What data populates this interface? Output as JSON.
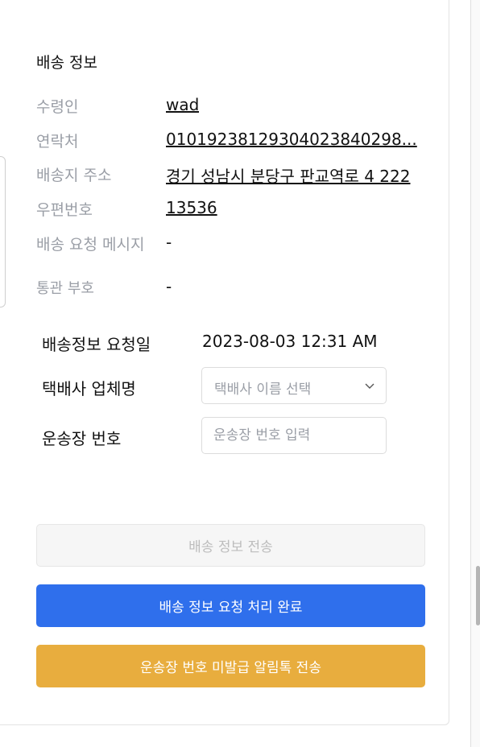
{
  "shipping_info": {
    "title": "배송 정보",
    "rows": [
      {
        "label": "수령인",
        "value": "wad"
      },
      {
        "label": "연락처",
        "value": "01019238129304023840298..."
      },
      {
        "label": "배송지 주소",
        "value": "경기 성남시 분당구 판교역로 4 222"
      },
      {
        "label": "우편번호",
        "value": "13536"
      },
      {
        "label": "배송 요청 메시지",
        "value": "-"
      },
      {
        "label": "통관 부호",
        "value": "-"
      }
    ]
  },
  "form": {
    "request_date_label": "배송정보 요청일",
    "request_date_value": "2023-08-03 12:31 AM",
    "courier_label": "택배사 업체명",
    "courier_placeholder": "택배사 이름 선택",
    "tracking_label": "운송장 번호",
    "tracking_placeholder": "운송장 번호 입력"
  },
  "buttons": {
    "send_shipping": "배송 정보 전송",
    "complete_request": "배송 정보 요청 처리 완료",
    "send_alert": "운송장 번호 미발급 알림톡 전송"
  },
  "colors": {
    "primary": "#2f6fec",
    "warning": "#e8ad3e",
    "muted_label": "#9a9ea6"
  }
}
